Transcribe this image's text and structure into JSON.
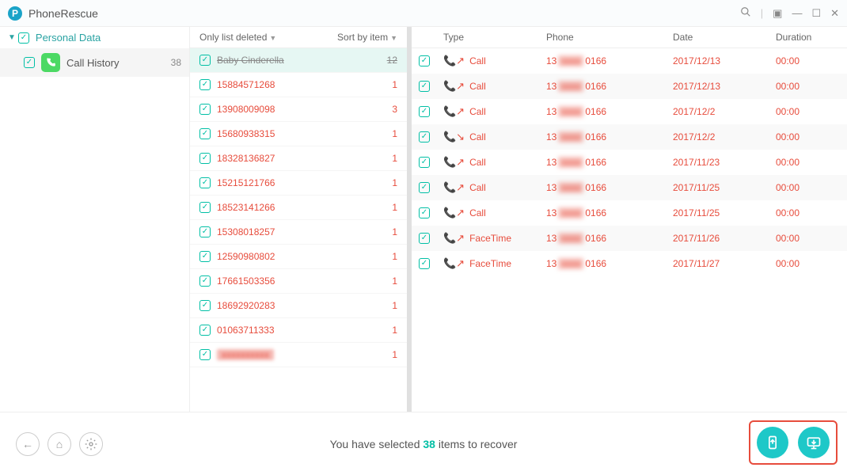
{
  "app": {
    "title": "PhoneRescue"
  },
  "sidebar": {
    "root_label": "Personal Data",
    "items": [
      {
        "label": "Call History",
        "count": "38"
      }
    ]
  },
  "mid": {
    "filter_label": "Only list deleted",
    "sort_label": "Sort by item",
    "rows": [
      {
        "name": "Baby Cinderella",
        "count": "12",
        "strike": true,
        "selected": true,
        "blur": false
      },
      {
        "name": "15884571268",
        "count": "1",
        "strike": false,
        "selected": false,
        "blur": false
      },
      {
        "name": "13908009098",
        "count": "3",
        "strike": false,
        "selected": false,
        "blur": false
      },
      {
        "name": "15680938315",
        "count": "1",
        "strike": false,
        "selected": false,
        "blur": false
      },
      {
        "name": "18328136827",
        "count": "1",
        "strike": false,
        "selected": false,
        "blur": false
      },
      {
        "name": "15215121766",
        "count": "1",
        "strike": false,
        "selected": false,
        "blur": false
      },
      {
        "name": "18523141266",
        "count": "1",
        "strike": false,
        "selected": false,
        "blur": false
      },
      {
        "name": "15308018257",
        "count": "1",
        "strike": false,
        "selected": false,
        "blur": false
      },
      {
        "name": "12590980802",
        "count": "1",
        "strike": false,
        "selected": false,
        "blur": false
      },
      {
        "name": "17661503356",
        "count": "1",
        "strike": false,
        "selected": false,
        "blur": false
      },
      {
        "name": "18692920283",
        "count": "1",
        "strike": false,
        "selected": false,
        "blur": false
      },
      {
        "name": "01063711333",
        "count": "1",
        "strike": false,
        "selected": false,
        "blur": false
      },
      {
        "name": "xxxxxxxxxx",
        "count": "1",
        "strike": false,
        "selected": false,
        "blur": true
      }
    ]
  },
  "right": {
    "headers": {
      "type": "Type",
      "phone": "Phone",
      "date": "Date",
      "duration": "Duration"
    },
    "phone_prefix": "13",
    "phone_suffix": "0166",
    "rows": [
      {
        "type": "Call",
        "date": "2017/12/13",
        "duration": "00:00",
        "icon": "out"
      },
      {
        "type": "Call",
        "date": "2017/12/13",
        "duration": "00:00",
        "icon": "out"
      },
      {
        "type": "Call",
        "date": "2017/12/2",
        "duration": "00:00",
        "icon": "out"
      },
      {
        "type": "Call",
        "date": "2017/12/2",
        "duration": "00:00",
        "icon": "missed"
      },
      {
        "type": "Call",
        "date": "2017/11/23",
        "duration": "00:00",
        "icon": "out"
      },
      {
        "type": "Call",
        "date": "2017/11/25",
        "duration": "00:00",
        "icon": "out"
      },
      {
        "type": "Call",
        "date": "2017/11/25",
        "duration": "00:00",
        "icon": "out"
      },
      {
        "type": "FaceTime",
        "date": "2017/11/26",
        "duration": "00:00",
        "icon": "out"
      },
      {
        "type": "FaceTime",
        "date": "2017/11/27",
        "duration": "00:00",
        "icon": "out"
      }
    ]
  },
  "footer": {
    "msg_pre": "You have selected ",
    "msg_count": "38",
    "msg_post": " items to recover"
  }
}
